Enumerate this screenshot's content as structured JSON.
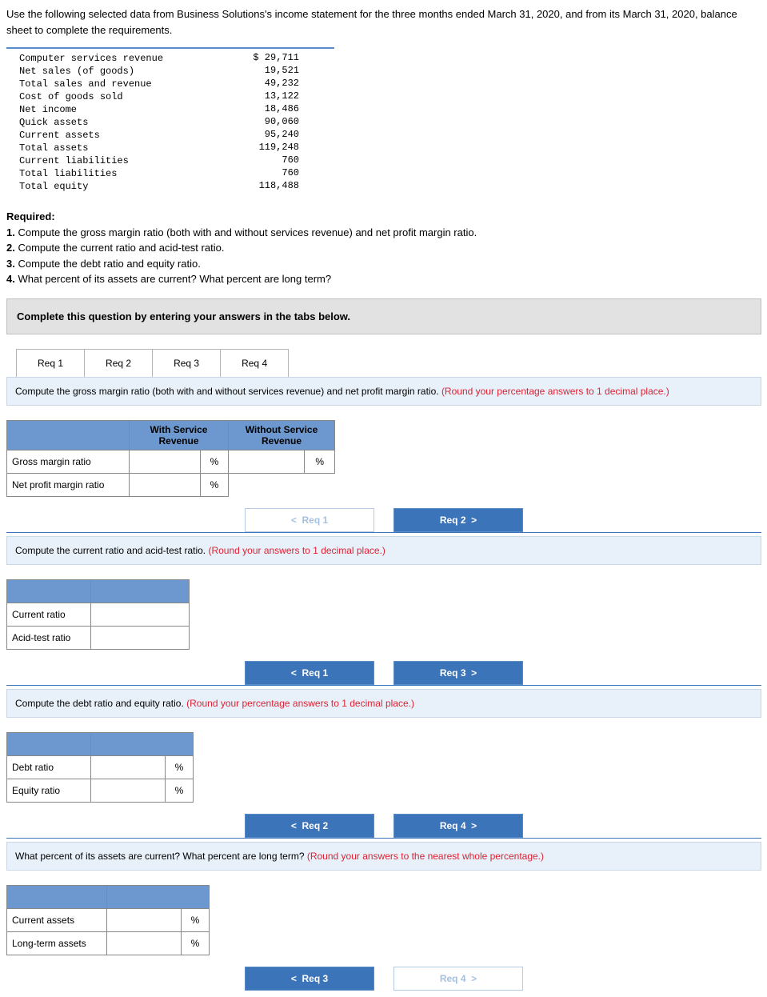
{
  "intro": "Use the following selected data from Business Solutions's income statement for the three months ended March 31, 2020, and from its March 31, 2020, balance sheet to complete the requirements.",
  "fin": {
    "rows": [
      {
        "label": "Computer services revenue",
        "value": "$ 29,711"
      },
      {
        "label": "Net sales (of goods)",
        "value": "19,521"
      },
      {
        "label": "Total sales and revenue",
        "value": "49,232"
      },
      {
        "label": "Cost of goods sold",
        "value": "13,122"
      },
      {
        "label": "Net income",
        "value": "18,486"
      },
      {
        "label": "Quick assets",
        "value": "90,060"
      },
      {
        "label": "Current assets",
        "value": "95,240"
      },
      {
        "label": "Total assets",
        "value": "119,248"
      },
      {
        "label": "Current liabilities",
        "value": "760"
      },
      {
        "label": "Total liabilities",
        "value": "760"
      },
      {
        "label": "Total equity",
        "value": "118,488"
      }
    ]
  },
  "required": {
    "title": "Required:",
    "items": [
      "Compute the gross margin ratio (both with and without services revenue) and net profit margin ratio.",
      "Compute the current ratio and acid-test ratio.",
      "Compute the debt ratio and equity ratio.",
      "What percent of its assets are current? What percent are long term?"
    ]
  },
  "instruction": "Complete this question by entering your answers in the tabs below.",
  "tabs": [
    "Req 1",
    "Req 2",
    "Req 3",
    "Req 4"
  ],
  "req1": {
    "prompt": "Compute the gross margin ratio (both with and without services revenue) and net profit margin ratio. ",
    "hint": "(Round your percentage answers to 1 decimal place.)",
    "col1": "With Service Revenue",
    "col2": "Without Service Revenue",
    "row1": "Gross margin ratio",
    "row2": "Net profit margin ratio",
    "pct": "%",
    "prev": "Req 1",
    "next": "Req 2"
  },
  "req2": {
    "prompt": "Compute the current ratio and acid-test ratio. ",
    "hint": "(Round your answers to 1 decimal place.)",
    "row1": "Current ratio",
    "row2": "Acid-test ratio",
    "prev": "Req 1",
    "next": "Req 3"
  },
  "req3": {
    "prompt": "Compute the debt ratio and equity ratio. ",
    "hint": "(Round your percentage answers to 1 decimal place.)",
    "row1": "Debt ratio",
    "row2": "Equity ratio",
    "pct": "%",
    "prev": "Req 2",
    "next": "Req 4"
  },
  "req4": {
    "prompt": "What percent of its assets are current? What percent are long term? ",
    "hint": "(Round your answers to the nearest whole percentage.)",
    "row1": "Current assets",
    "row2": "Long-term assets",
    "pct": "%",
    "prev": "Req 3",
    "next": "Req 4"
  }
}
